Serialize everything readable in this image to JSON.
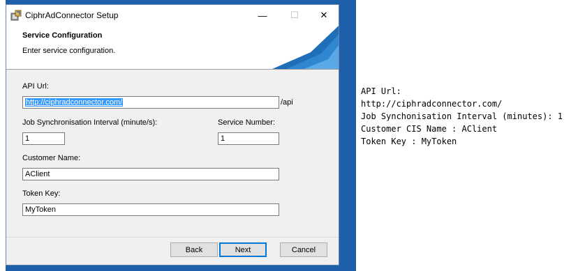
{
  "window": {
    "title": "CiphrAdConnector Setup",
    "minimize_glyph": "—",
    "maximize_glyph": "☐",
    "close_glyph": "✕"
  },
  "banner": {
    "heading": "Service Configuration",
    "subheading": "Enter service configuration."
  },
  "form": {
    "api_url_label": "API Url:",
    "api_url_value": "http://ciphradconnector.com/",
    "api_suffix": "/api",
    "job_interval_label": "Job Synchronisation Interval (minute/s):",
    "job_interval_value": "1",
    "service_number_label": "Service Number:",
    "service_number_value": "1",
    "customer_name_label": "Customer Name:",
    "customer_name_value": "AClient",
    "token_key_label": "Token Key:",
    "token_key_value": "MyToken"
  },
  "buttons": {
    "back": "Back",
    "next": "Next",
    "cancel": "Cancel"
  },
  "notes": [
    "API Url:",
    "http://ciphradconnector.com/",
    "Job Synchonisation Interval (minutes): 1",
    "Customer CIS Name : AClient",
    "Token Key : MyToken"
  ],
  "colors": {
    "desktop": "#1d5fa8",
    "selection": "#3399ff",
    "default_button_border": "#0078d7"
  }
}
